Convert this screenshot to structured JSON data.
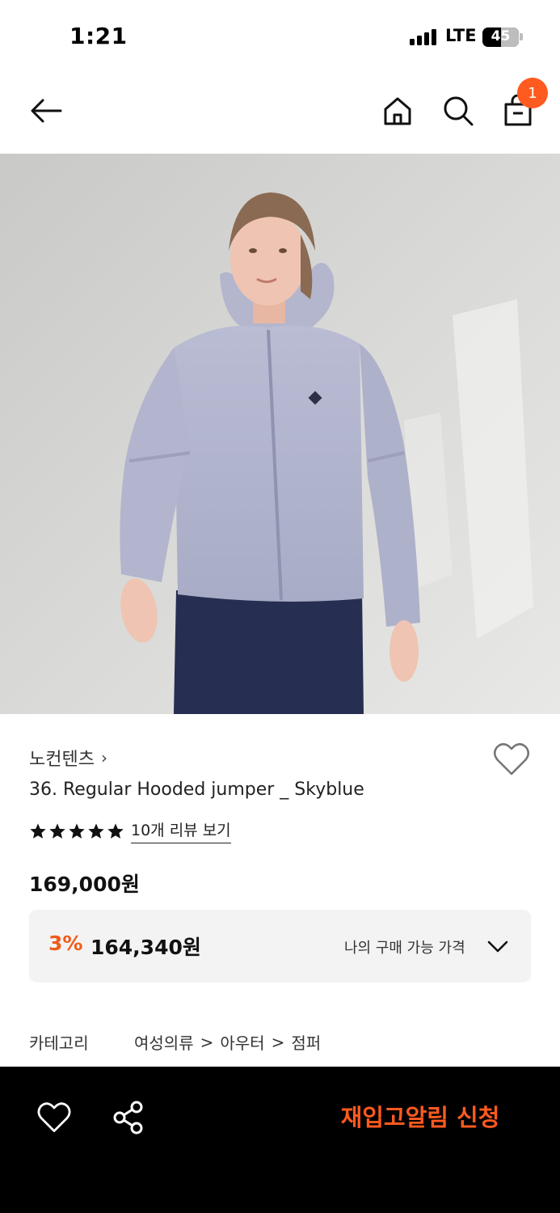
{
  "status": {
    "time": "1:21",
    "network": "LTE",
    "battery": "45",
    "battery_level": 0.45
  },
  "header": {
    "back_icon": "arrow-left-icon",
    "home_icon": "home-icon",
    "search_icon": "search-icon",
    "cart_icon": "shopping-bag-icon",
    "cart_count": "1"
  },
  "product": {
    "image_icon": "product-photo",
    "brand": "노컨텐츠",
    "brand_chevron": "›",
    "name": "36. Regular Hooded jumper _ Skyblue",
    "rating_stars": 5,
    "review_link": "10개 리뷰 보기",
    "price": "169,000원",
    "discount_rate": "3%",
    "discount_price": "164,340원",
    "my_price_label": "나의 구매 가능 가격",
    "category_label": "카테고리",
    "categories": [
      "여성의류",
      "아우터",
      "점퍼"
    ],
    "category_sep": ">"
  },
  "bottom_bar": {
    "wish_icon": "heart-icon",
    "share_icon": "share-icon",
    "restock_label": "재입고알림 신청"
  },
  "colors": {
    "accent": "#ff5a1f",
    "discount": "#f05a1a",
    "bottom_bar_bg": "#000000"
  }
}
